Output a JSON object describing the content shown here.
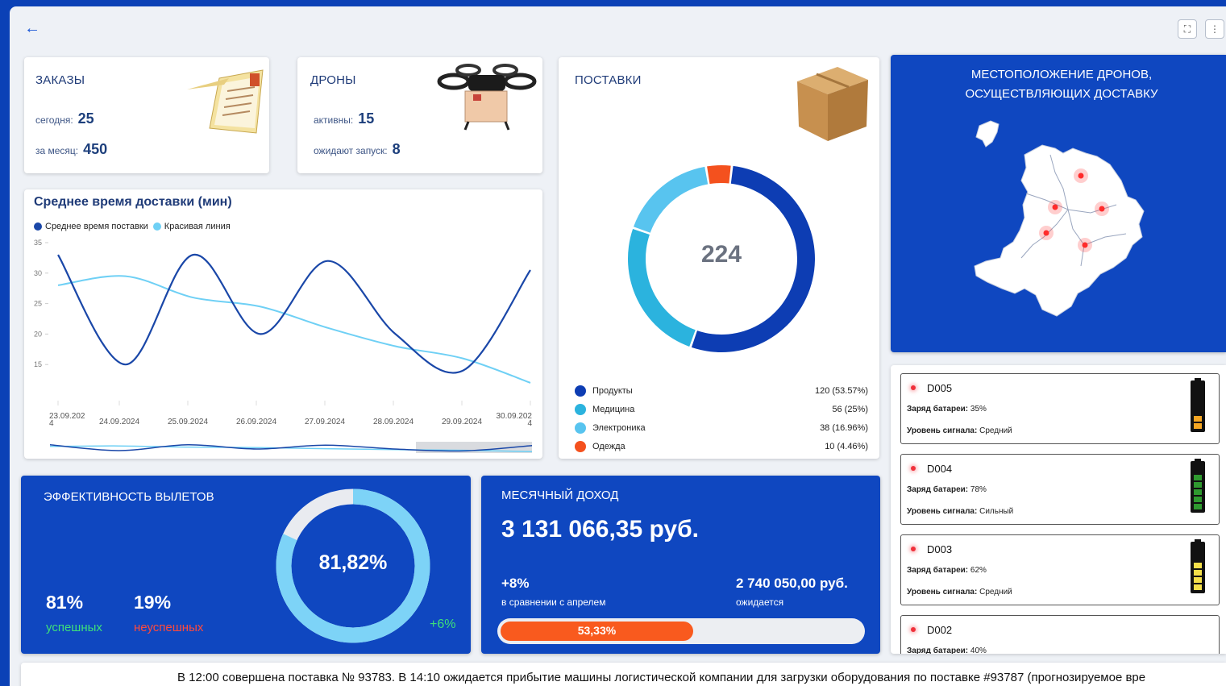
{
  "orders": {
    "title": "ЗАКАЗЫ",
    "today_label": "сегодня:",
    "today_value": "25",
    "month_label": "за месяц:",
    "month_value": "450"
  },
  "drones": {
    "title": "ДРОНЫ",
    "active_label": "активны:",
    "active_value": "15",
    "waiting_label": "ожидают запуск:",
    "waiting_value": "8"
  },
  "deliveries": {
    "title": "ПОСТАВКИ",
    "total": "224",
    "legend": [
      {
        "name": "Продукты",
        "value": "120 (53.57%)",
        "color": "#0d3db3"
      },
      {
        "name": "Медицина",
        "value": "56 (25%)",
        "color": "#2bb3de"
      },
      {
        "name": "Электроника",
        "value": "38 (16.96%)",
        "color": "#58c4ef"
      },
      {
        "name": "Одежда",
        "value": "10 (4.46%)",
        "color": "#f4511e"
      }
    ]
  },
  "map": {
    "title_line1": "МЕСТОПОЛОЖЕНИЕ ДРОНОВ,",
    "title_line2": "ОСУЩЕСТВЛЯЮЩИХ ДОСТАВКУ"
  },
  "chart_data": {
    "type": "line",
    "title": "Среднее время доставки (мин)",
    "x": [
      "23.09.2024",
      "24.09.2024",
      "25.09.2024",
      "26.09.2024",
      "27.09.2024",
      "28.09.2024",
      "29.09.2024",
      "30.09.2024"
    ],
    "series": [
      {
        "name": "Среднее время поставки",
        "color": "#1a47a8",
        "values": [
          33,
          15,
          33,
          20,
          32,
          20,
          14,
          30.5
        ]
      },
      {
        "name": "Красивая линия",
        "color": "#6fd0f5",
        "values": [
          28,
          29.5,
          26,
          24.5,
          21,
          18,
          16,
          12
        ]
      }
    ],
    "ylim": [
      10,
      35
    ],
    "yticks": [
      "35",
      "30",
      "25",
      "20",
      "15"
    ],
    "grid": false,
    "legend": "top-left"
  },
  "efficiency": {
    "title": "ЭФФЕКТИВНОСТЬ ВЫЛЕТОВ",
    "success_pct": "81%",
    "success_label": "успешных",
    "fail_pct": "19%",
    "fail_label": "неуспешных",
    "gauge_value": "81,82%",
    "gauge_fraction": 0.8182,
    "delta": "+6%"
  },
  "revenue": {
    "title": "МЕСЯЧНЫЙ ДОХОД",
    "amount": "3 131 066,35 руб.",
    "delta": "+8%",
    "delta_label": "в сравнении с апрелем",
    "expected_amount": "2 740 050,00 руб.",
    "expected_label": "ожидается",
    "progress_label": "53,33%",
    "progress_fraction": 0.5333
  },
  "drone_list": [
    {
      "id": "D005",
      "battery_label": "Заряд батареи:",
      "battery_value": "35%",
      "battery_fraction": 0.35,
      "signal_label": "Уровень сигнала:",
      "signal_value": "Средний",
      "battery_color": "#f5a623"
    },
    {
      "id": "D004",
      "battery_label": "Заряд батареи:",
      "battery_value": "78%",
      "battery_fraction": 0.78,
      "signal_label": "Уровень сигнала:",
      "signal_value": "Сильный",
      "battery_color": "#2f9a2f"
    },
    {
      "id": "D003",
      "battery_label": "Заряд батареи:",
      "battery_value": "62%",
      "battery_fraction": 0.62,
      "signal_label": "Уровень сигнала:",
      "signal_value": "Средний",
      "battery_color": "#f5e04a"
    },
    {
      "id": "D002",
      "battery_label": "Заряд батареи:",
      "battery_value": "40%"
    }
  ],
  "ticker": {
    "text": "В 12:00 совершена поставка № 93783. В 14:10 ожидается прибытие машины логистической компании для загрузки оборудования по поставке #93787 (прогнозируемое вре"
  }
}
